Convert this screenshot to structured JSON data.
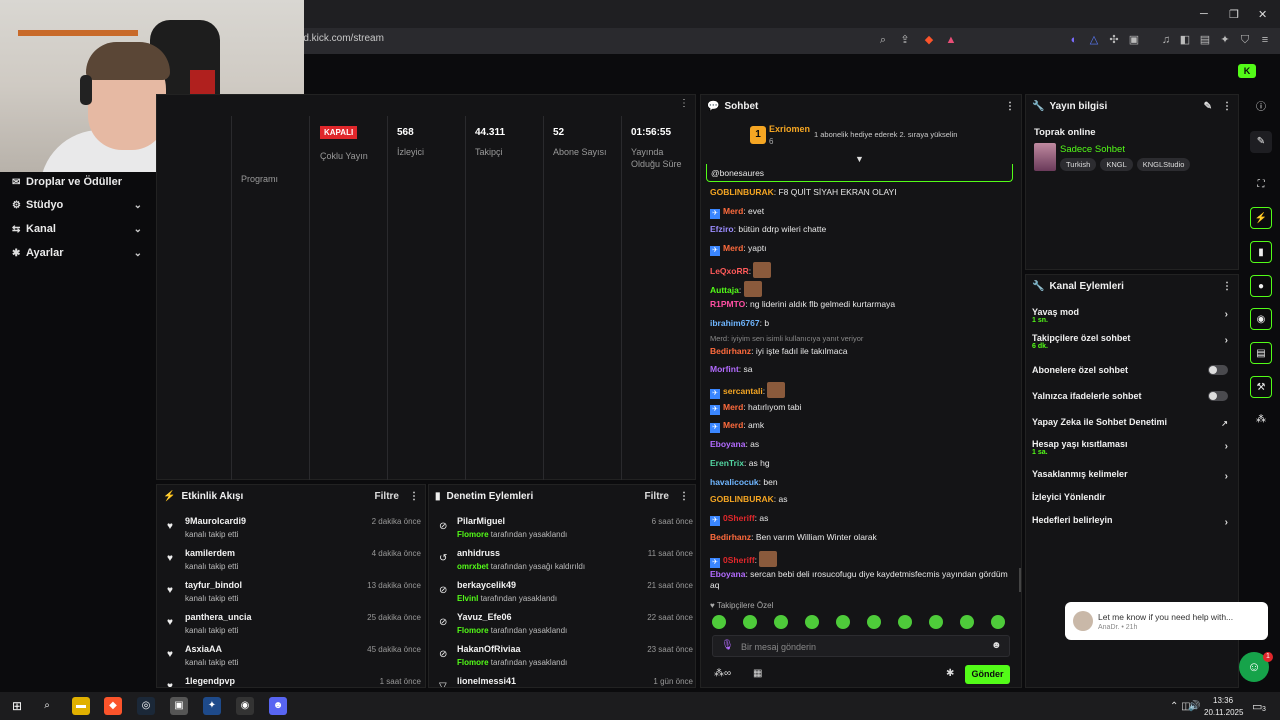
{
  "browser": {
    "url": "rd.kick.com/stream",
    "window_controls": {
      "minimize": "─",
      "maximize": "❐",
      "close": "✕"
    }
  },
  "sidebar": {
    "items": [
      {
        "icon": "gift-icon",
        "label": "Droplar ve Ödüller",
        "expandable": false
      },
      {
        "icon": "studio-icon",
        "label": "Stüdyo",
        "expandable": true
      },
      {
        "icon": "channel-icon",
        "label": "Kanal",
        "expandable": true
      },
      {
        "icon": "settings-icon",
        "label": "Ayarlar",
        "expandable": true
      }
    ],
    "partial_label": "Programı"
  },
  "stats": {
    "status": "KAPALI",
    "multi_stream": "Çoklu Yayın",
    "viewers_value": "568",
    "viewers_label": "İzleyici",
    "followers_value": "44.311",
    "followers_label": "Takipçi",
    "subs_value": "52",
    "subs_label": "Abone Sayısı",
    "uptime_value": "01:56:55",
    "uptime_label": "Yayında Olduğu Süre"
  },
  "activity": {
    "title": "Etkinlik Akışı",
    "filter": "Filtre",
    "rows": [
      {
        "name": "9Maurolcardi9",
        "sub": "kanalı takip etti",
        "time": "2 dakika önce"
      },
      {
        "name": "kamilerdem",
        "sub": "kanalı takip etti",
        "time": "4 dakika önce"
      },
      {
        "name": "tayfur_bindol",
        "sub": "kanalı takip etti",
        "time": "13 dakika önce"
      },
      {
        "name": "panthera_uncia",
        "sub": "kanalı takip etti",
        "time": "25 dakika önce"
      },
      {
        "name": "AsxiaAA",
        "sub": "kanalı takip etti",
        "time": "45 dakika önce"
      },
      {
        "name": "1legendpvp",
        "sub": "",
        "time": "1 saat önce"
      }
    ]
  },
  "moderation": {
    "title": "Denetim Eylemleri",
    "filter": "Filtre",
    "rows": [
      {
        "name": "PilarMiguel",
        "by": "Flomore",
        "sub": " tarafından yasaklandı",
        "time": "6 saat önce",
        "icon": "ban"
      },
      {
        "name": "anhidruss",
        "by": "omrxbet",
        "sub": " tarafından yasağı kaldırıldı",
        "time": "11 saat önce",
        "icon": "undo"
      },
      {
        "name": "berkaycelik49",
        "by": "Elvinl",
        "sub": " tarafından yasaklandı",
        "time": "21 saat önce",
        "icon": "ban"
      },
      {
        "name": "Yavuz_Efe06",
        "by": "Flomore",
        "sub": " tarafından yasaklandı",
        "time": "22 saat önce",
        "icon": "ban"
      },
      {
        "name": "HakanOfRiviaa",
        "by": "Flomore",
        "sub": " tarafından yasaklandı",
        "time": "23 saat önce",
        "icon": "ban"
      },
      {
        "name": "lionelmessi41",
        "by": "",
        "sub": "",
        "time": "1 gün önce",
        "icon": "ban"
      }
    ]
  },
  "chat": {
    "title": "Sohbet",
    "pinned_user": "Exriomen",
    "pinned_count": "6",
    "pinned_rank": "1",
    "pinned_text": "1 abonelik hediye ederek 2. sıraya yükselin",
    "mention": "@bonesaures",
    "messages": [
      {
        "user": "GOBLINBURAK",
        "color": "#f5a623",
        "text": ": F8 QUİT SİYAH EKRAN OLAYI",
        "badge": false
      },
      {
        "user": "Merd",
        "color": "#ff6b3d",
        "text": ": evet",
        "badge": true
      },
      {
        "user": "Efziro",
        "color": "#9b8cff",
        "text": ": bütün ddrp wileri chatte",
        "badge": false
      },
      {
        "user": "Merd",
        "color": "#ff6b3d",
        "text": ": yaptı",
        "badge": true
      },
      {
        "user": "LeQxoRR",
        "color": "#ff5a5a",
        "text": ":",
        "badge": false,
        "emote": true
      },
      {
        "user": "Auttaja",
        "color": "#53fc18",
        "text": ":",
        "badge": false,
        "emote": true
      },
      {
        "user": "R1PMTO",
        "color": "#ff4fa3",
        "text": ": ng liderini aldık flb gelmedi kurtarmaya",
        "badge": false
      },
      {
        "user": "ibrahim6767",
        "color": "#6fb6ff",
        "text": ": b",
        "badge": false
      },
      {
        "user": "Bedirhanz",
        "color": "#ff6b3d",
        "text": ": iyi işte fadıl ile takılmaca",
        "badge": false
      },
      {
        "user": "Morfint",
        "color": "#b36bff",
        "text": ": sa",
        "badge": false
      },
      {
        "user": "sercantali",
        "color": "#f5a623",
        "text": ":",
        "badge": true,
        "emote": true
      },
      {
        "user": "Merd",
        "color": "#ff6b3d",
        "text": ": hatırlıyom tabi",
        "badge": true
      },
      {
        "user": "Merd",
        "color": "#ff6b3d",
        "text": ": amk",
        "badge": true
      },
      {
        "user": "Eboyana",
        "color": "#b36bff",
        "text": ": as",
        "badge": false
      },
      {
        "user": "ErenTrix",
        "color": "#53d7a3",
        "text": ": as hg",
        "badge": false
      },
      {
        "user": "havalicocuk",
        "color": "#6fb6ff",
        "text": ": ben",
        "badge": false
      },
      {
        "user": "GOBLINBURAK",
        "color": "#f5a623",
        "text": ": as",
        "badge": false
      },
      {
        "user": "0Sheriff",
        "color": "#e0272b",
        "text": ": as",
        "badge": true
      },
      {
        "user": "Bedirhanz",
        "color": "#ff6b3d",
        "text": ": Ben varım William Winter olarak",
        "badge": false
      },
      {
        "user": "0Sheriff",
        "color": "#e0272b",
        "text": ":",
        "badge": true,
        "emote": true
      },
      {
        "user": "Eboyana",
        "color": "#b36bff",
        "text": ": sercan bebi deli ırosucofugu diye kaydetmisfecmis yayından gördüm aq",
        "badge": false
      }
    ],
    "reply_note": "Merd: iyiyim sen isimli kullanıcıya yanıt veriyor",
    "followers_only": "Takipçilere Özel",
    "input_placeholder": "Bir mesaj gönderin",
    "send": "Gönder"
  },
  "stream_info": {
    "title": "Yayın bilgisi",
    "stream_title": "Toprak online",
    "category": "Sadece Sohbet",
    "tags": [
      "Turkish",
      "KNGL",
      "KNGLStudio"
    ]
  },
  "channel_actions": {
    "title": "Kanal Eylemleri",
    "items": [
      {
        "label": "Yavaş mod",
        "sub": "1 sn.",
        "control": "chevron"
      },
      {
        "label": "Takipçilere özel sohbet",
        "sub": "6 dk.",
        "control": "chevron"
      },
      {
        "label": "Abonelere özel sohbet",
        "sub": "",
        "control": "toggle"
      },
      {
        "label": "Yalnızca ifadelerle sohbet",
        "sub": "",
        "control": "toggle"
      },
      {
        "label": "Yapay Zeka ile Sohbet Denetimi",
        "sub": "",
        "control": "external"
      },
      {
        "label": "Hesap yaşı kısıtlaması",
        "sub": "1 sa.",
        "control": "chevron"
      },
      {
        "label": "Yasaklanmış kelimeler",
        "sub": "",
        "control": "chevron"
      },
      {
        "label": "İzleyici Yönlendir",
        "sub": "",
        "control": "none"
      },
      {
        "label": "Hedefleri belirleyin",
        "sub": "",
        "control": "chevron"
      }
    ]
  },
  "toast": {
    "text": "Let me know if you need help with...",
    "meta": "AnaDr. • 21h",
    "badge": "1"
  },
  "taskbar": {
    "time": "13:36",
    "date": "20.11.2025",
    "notif": "3"
  }
}
